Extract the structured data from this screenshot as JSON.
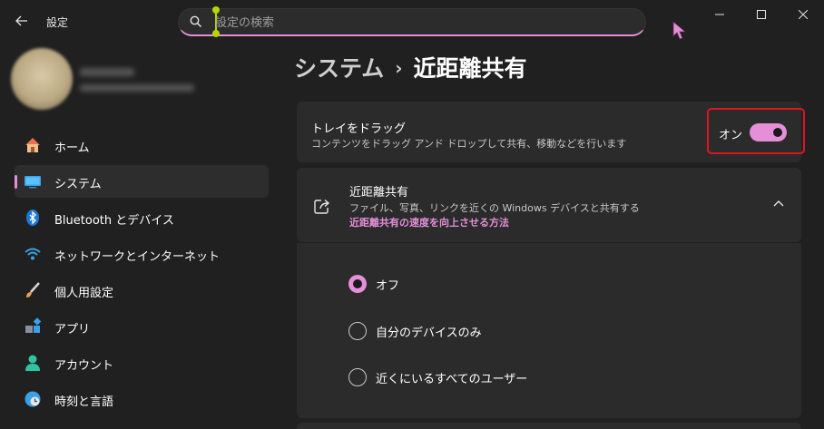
{
  "app": {
    "title": "設定"
  },
  "search": {
    "placeholder": "設定の検索"
  },
  "nav": {
    "items": [
      {
        "label": "ホーム"
      },
      {
        "label": "システム"
      },
      {
        "label": "Bluetooth とデバイス"
      },
      {
        "label": "ネットワークとインターネット"
      },
      {
        "label": "個人用設定"
      },
      {
        "label": "アプリ"
      },
      {
        "label": "アカウント"
      },
      {
        "label": "時刻と言語"
      }
    ]
  },
  "breadcrumb": {
    "parent": "システム",
    "separator": "›",
    "current": "近距離共有"
  },
  "tray_drag": {
    "title": "トレイをドラッグ",
    "description": "コンテンツをドラッグ アンド ドロップして共有、移動などを行います",
    "toggle_state": "オン",
    "toggle_on": true
  },
  "nearby_sharing": {
    "title": "近距離共有",
    "description": "ファイル、写真、リンクを近くの Windows デバイスと共有する",
    "link": "近距離共有の速度を向上させる方法",
    "options": [
      {
        "label": "オフ",
        "selected": true
      },
      {
        "label": "自分のデバイスのみ",
        "selected": false
      },
      {
        "label": "近くにいるすべてのユーザー",
        "selected": false
      }
    ]
  },
  "colors": {
    "accent": "#e58fd8",
    "highlight_border": "#e0141f",
    "background": "#202020",
    "card": "#2b2b2b"
  }
}
